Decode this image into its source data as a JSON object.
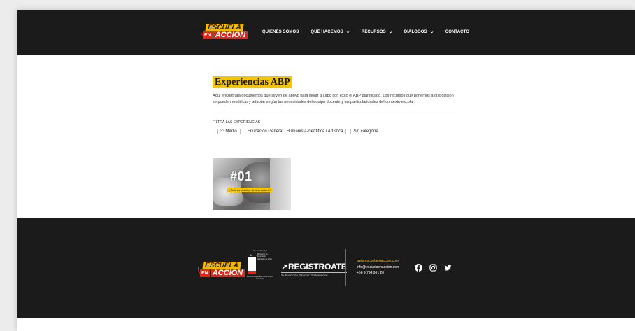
{
  "brand": {
    "line1": "ESCUELA",
    "line2_small": "EN",
    "line2_main": "ACCIÓN"
  },
  "nav": {
    "items": [
      {
        "label": "QUIENES SOMOS",
        "dropdown": false
      },
      {
        "label": "QUÉ HACEMOS",
        "dropdown": true
      },
      {
        "label": "RECURSOS",
        "dropdown": true
      },
      {
        "label": "DIÁLOGOS",
        "dropdown": true
      },
      {
        "label": "CONTACTO",
        "dropdown": false
      }
    ],
    "chevron": "⌄"
  },
  "main": {
    "title": "Experiencias ABP",
    "description": "Aquí encontrará documentos que sirven de apoyo para llevar a cabo con éxito el ABP planificado. Los recursos que ponemos a disposición se pueden modificar y adaptar según las necesidades del equipo docente y las particularidades del contexto escolar.",
    "filter_title": "FILTRA LAS EXPERIENCIAS",
    "filters": [
      {
        "label": "3° Medio",
        "checked": false
      },
      {
        "label": "Educación General / Humanista-científica / Artística",
        "checked": false
      },
      {
        "label": "Sin categoría",
        "checked": false
      }
    ],
    "card": {
      "number": "#01",
      "tag": "¿Cuál es el sabor de una cultura?"
    }
  },
  "footer": {
    "gov": {
      "small": "Financiado por",
      "text": "Ministerio de Educación Gobierno de Chile",
      "bottom": "Fondos Regionales 2019 Región del Maule"
    },
    "reg_main": "REGISTROATE",
    "reg_sub": "Subvención Escolar Preferencial",
    "web": "www.escuelaenaccion.com",
    "email": "info@escuelaenaccion.com",
    "phone": "+56 9 794 961 20",
    "socials": [
      "facebook-icon",
      "instagram-icon",
      "twitter-icon"
    ]
  },
  "colors": {
    "header_bg": "#1b1b1b",
    "accent_yellow": "#f5c400",
    "accent_red": "#d92a1c",
    "footer_bg": "#1b1b1b"
  }
}
